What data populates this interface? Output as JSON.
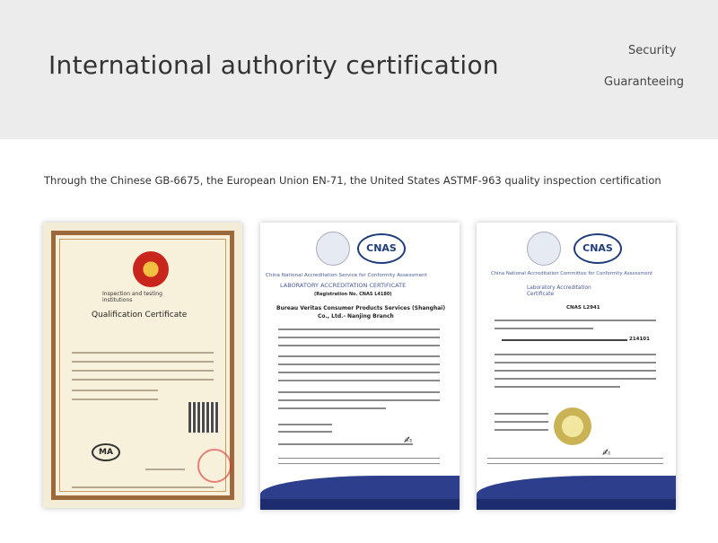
{
  "header": {
    "title": "International authority certification",
    "side_line1": "Security",
    "side_line2": "Guaranteeing"
  },
  "description": "Through the Chinese GB-6675, the European Union EN-71, the United States ASTMF-963 quality inspection certification",
  "cert1": {
    "small_text_line1": "Inspection and testing",
    "small_text_line2": "institutions",
    "name": "Qualification Certificate",
    "ma_label": "MA"
  },
  "cert2": {
    "iac_label": "ilac-MRA",
    "cnas_label": "CNAS",
    "service_line": "China National Accreditation Service for Conformity Assessment",
    "cert_title": "LABORATORY ACCREDITATION CERTIFICATE",
    "reg_no": "(Registration No. CNAS L4180)",
    "org_line1": "Bureau Veritas Consumer Products Services (Shanghai)",
    "org_line2": "Co., Ltd.- Nanjing Branch"
  },
  "cert3": {
    "iac_label": "ilac-MRA",
    "cnas_label": "CNAS",
    "committee_line": "China National Accreditation Committee for Conformity Assessment",
    "lab_line1": "Laboratory Accreditation",
    "lab_line2": "Certificate",
    "cn_reg_no": "CNAS L2941",
    "address_line": "214101"
  },
  "colors": {
    "header_bg": "#ececec",
    "cert_blue": "#2d3f8c",
    "frame_brown": "#9c6a3a"
  }
}
